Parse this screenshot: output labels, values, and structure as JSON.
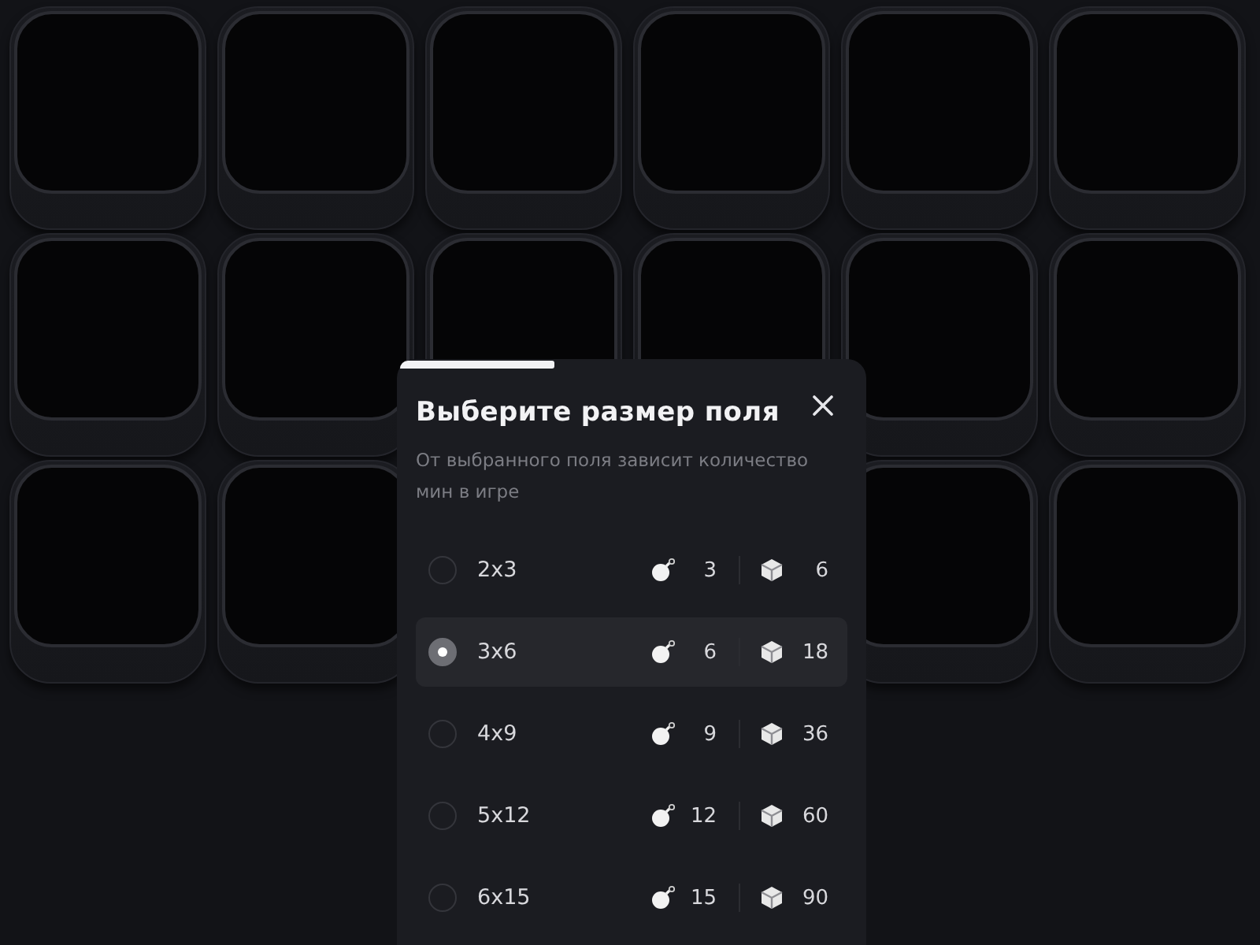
{
  "dialog": {
    "title": "Выберите размер поля",
    "subtitle": "От выбранного поля зависит количество мин в игре",
    "options": [
      {
        "label": "2x3",
        "mines": "3",
        "cells": "6",
        "selected": false
      },
      {
        "label": "3x6",
        "mines": "6",
        "cells": "18",
        "selected": true
      },
      {
        "label": "4x9",
        "mines": "9",
        "cells": "36",
        "selected": false
      },
      {
        "label": "5x12",
        "mines": "12",
        "cells": "60",
        "selected": false
      },
      {
        "label": "6x15",
        "mines": "15",
        "cells": "90",
        "selected": false
      }
    ]
  }
}
